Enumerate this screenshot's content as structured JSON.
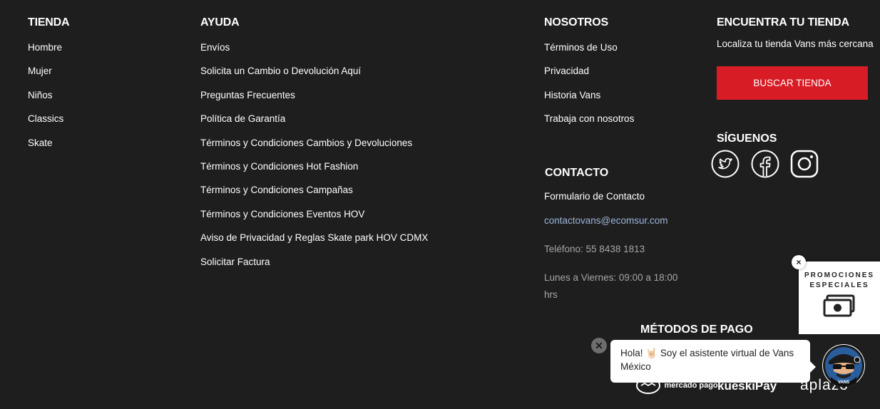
{
  "tienda": {
    "title": "TIENDA",
    "links": [
      "Hombre",
      "Mujer",
      "Niños",
      "Classics",
      "Skate"
    ]
  },
  "ayuda": {
    "title": "AYUDA",
    "links": [
      "Envíos",
      "Solicita un Cambio o Devolución Aquí",
      "Preguntas Frecuentes",
      "Política de Garantía",
      "Términos y Condiciones Cambios y Devoluciones",
      "Términos y Condiciones Hot Fashion",
      "Términos y Condiciones Campañas",
      "Términos y Condiciones Eventos HOV",
      "Aviso de Privacidad y Reglas Skate park HOV CDMX",
      "Solicitar Factura"
    ]
  },
  "nosotros": {
    "title": "NOSOTROS",
    "links": [
      "Términos de Uso",
      "Privacidad",
      "Historia Vans",
      "Trabaja con nosotros"
    ]
  },
  "contacto": {
    "title": "CONTACTO",
    "form_link": "Formulario de Contacto",
    "email": "contactovans@ecomsur.com",
    "phone": "Teléfono: 55 8438 1813",
    "hours_line1": "Lunes a Viernes: 09:00 a 18:00",
    "hours_line2": "hrs"
  },
  "find_store": {
    "title": "ENCUENTRA TU TIENDA",
    "subtitle": "Localiza tu tienda Vans más cercana",
    "button": "BUSCAR TIENDA"
  },
  "social": {
    "title": "SÍGUENOS",
    "icons": [
      "twitter-icon",
      "facebook-icon",
      "instagram-icon"
    ]
  },
  "payment": {
    "title": "MÉTODOS DE PAGO",
    "logos": [
      "mercado pago",
      "kueskiPay",
      "aplazo"
    ]
  },
  "promo": {
    "line1": "PROMOCIONES",
    "line2": "ESPECIALES",
    "close": "×"
  },
  "chat": {
    "message": "Hola! 🤘🏻 Soy el asistente virtual de Vans México",
    "close": "✕",
    "avatar_label": "VANS"
  },
  "colors": {
    "background": "#1f1e1f",
    "accent": "#d71c25",
    "link": "#9bb4d6"
  }
}
